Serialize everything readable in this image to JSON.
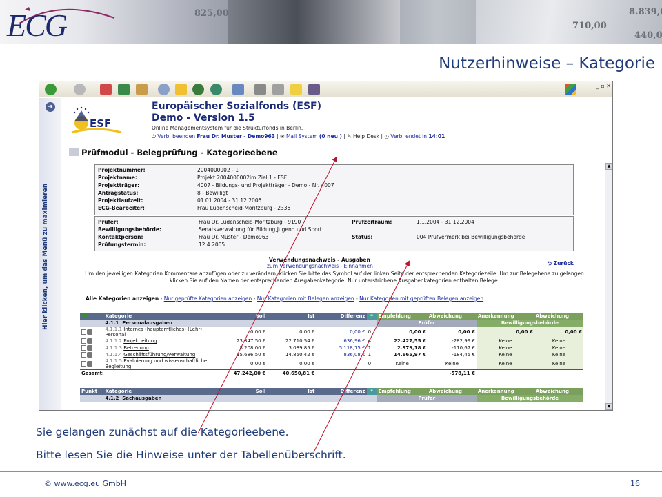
{
  "slide": {
    "logo_text": "ECG",
    "title": "Nutzerhinweise – Kategorie",
    "caption_1": "Sie gelangen zunächst auf die Kategorieebene.",
    "caption_2": "Bitte lesen Sie die Hinweise unter der Tabellenüberschrift.",
    "copyright": "© www.ecg.eu GmbH",
    "page_number": "16",
    "banner_numbers": [
      "825,00",
      "8.839,0",
      "710,00",
      "440,0"
    ]
  },
  "browser": {
    "toolbar_icons": [
      "back-icon",
      "forward-icon",
      "stop-icon",
      "refresh-icon",
      "home-icon",
      "search-icon",
      "favorites-icon",
      "media-icon",
      "history-icon",
      "mail-icon",
      "print-icon",
      "edit-icon",
      "folder-icon",
      "messenger-icon"
    ],
    "window_buttons": "_ ▫ ✕"
  },
  "app": {
    "logo_text": "ESF",
    "title": "Europäischer Sozialfonds (ESF)",
    "subtitle": "Demo - Version 1.5",
    "description": "Online Managementsystem für die Strukturfonds in Berlin.",
    "status": {
      "user_prefix": "Verb. beenden",
      "user": "Frau Dr. Muster - Demo963",
      "mail_prefix": "Mail System",
      "mail": "(0 neu )",
      "help": "Help Desk",
      "session_prefix": "Verb. endet in",
      "session": "14:01"
    },
    "left_menu_text": "Hier klicken, um das Menü zu maximieren",
    "module_title": "Prüfmodul - Belegprüfung - Kategorieebene",
    "project": [
      {
        "k": "Projektnummer:",
        "v": "2004000002 - 1"
      },
      {
        "k": "Projektname:",
        "v": "Projekt 2004000002im Ziel 1 - ESF"
      },
      {
        "k": "Projektträger:",
        "v": "4007 - Bildungs- und Projektträger - Demo - Nr. 4007"
      },
      {
        "k": "Antragstatus:",
        "v": "8 - Bewilligt"
      },
      {
        "k": "Projektlaufzeit:",
        "v": "01.01.2004 - 31.12.2005"
      },
      {
        "k": "ECG-Bearbeiter:",
        "v": "Frau Lüdenscheid-Moritzburg - 2335"
      }
    ],
    "pruefung": {
      "pruefer_k": "Prüfer:",
      "pruefer_v": "Frau Dr. Lüdenscheid-Moritzburg - 9190",
      "zeitraum_k": "Prüfzeitraum:",
      "zeitraum_v": "1.1.2004 - 31.12.2004",
      "behoerde_k": "Bewilligungsbehörde:",
      "behoerde_v": "Senatsverwaltung für Bildung,Jugend und Sport",
      "kontakt_k": "Kontaktperson:",
      "kontakt_v": "Frau Dr. Muster - Demo963",
      "status_k": "Status:",
      "status_v": "004 Prüfvermerk bei Bewilligungsbehörde",
      "termin_k": "Prüfungstermin:",
      "termin_v": "12.4.2005"
    },
    "verwendungsnachweis_title": "Verwendungsnachweis - Ausgaben",
    "verwendungsnachweis_link": "zum Verwendungsnachweis - Einnahmen",
    "back_label": "Zurück",
    "hint": "Um den jeweiligen Kategorien Kommentare anzufügen oder zu verändern, klicken Sie bitte das Symbol  auf der linken Seite der entsprechenden Kategoriezeile. Um zur Belegebene zu gelangen klicken Sie auf den Namen der entsprechenden Ausgabenkategorie. Nur unterstrichene Ausgabenkategorien enthalten Belege.",
    "filter": {
      "all": "Alle Kategorien anzeigen",
      "f1": "Nur geprüfte Kategorien anzeigen",
      "f2": "Nur Kategorien mit Belegen anzeigen",
      "f3": "Nur Kategorien mit geprüften Belegen anzeigen",
      "sep": " - "
    },
    "table_headers": [
      "Punkt",
      "Kategorie",
      "Soll",
      "Ist",
      "Differenz",
      "*",
      "Empfehlung",
      "Abweichung",
      "Anerkennung",
      "Abweichung"
    ],
    "group_pruefer": "Prüfer",
    "group_behoerde": "Bewilligungsbehörde",
    "section1": {
      "nr": "4.1.1",
      "name": "Personalausgaben"
    },
    "rows": [
      {
        "nr": "4.1.1.1",
        "kat": "Internes (hauptamtliches) (Lehr) Personal",
        "soll": "0,00 €",
        "ist": "0,00 €",
        "diff": "0,00 €",
        "star": "0",
        "empf": "0,00 €",
        "abw": "0,00 €",
        "anerk": "0,00 €",
        "abw2": "0,00 €",
        "link": false
      },
      {
        "nr": "4.1.1.2",
        "kat": "Projektleitung",
        "soll": "23.347,50 €",
        "ist": "22.710,54 €",
        "diff": "636,96 €",
        "star": "4",
        "empf": "22.427,55 €",
        "abw": "-282,99 €",
        "anerk": "Keine",
        "abw2": "Keine",
        "link": true
      },
      {
        "nr": "4.1.1.3",
        "kat": "Betreuung",
        "soll": "8.208,00 €",
        "ist": "3.089,85 €",
        "diff": "5.118,15 €",
        "star": "1",
        "empf": "2.979,18 €",
        "abw": "-110,67 €",
        "anerk": "Keine",
        "abw2": "Keine",
        "link": true
      },
      {
        "nr": "4.1.1.4",
        "kat": "Geschäftsführung/Verwaltung",
        "soll": "15.686,50 €",
        "ist": "14.850,42 €",
        "diff": "836,08 €",
        "star": "1",
        "empf": "14.665,97 €",
        "abw": "-184,45 €",
        "anerk": "Keine",
        "abw2": "Keine",
        "link": true
      },
      {
        "nr": "4.1.1.5",
        "kat": "Evaluierung und wissenschaftliche Begleitung",
        "soll": "0,00 €",
        "ist": "0,00 €",
        "diff": "",
        "star": "0",
        "empf": "Keine",
        "abw": "Keine",
        "anerk": "Keine",
        "abw2": "Keine",
        "link": false
      }
    ],
    "sum": {
      "label": "Gesamt:",
      "soll": "47.242,00 €",
      "ist": "40.650,81 €",
      "abw": "-578,11 €"
    },
    "section2": {
      "nr": "4.1.2",
      "name": "Sachausgaben"
    }
  }
}
